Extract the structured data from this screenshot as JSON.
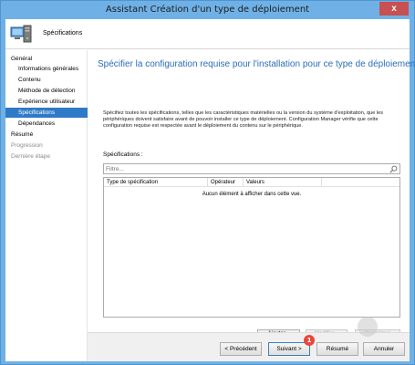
{
  "window": {
    "title": "Assistant Création d'un type de déploiement",
    "close_glyph": "x"
  },
  "header": {
    "title": "Spécifications",
    "icon": "computer-icon"
  },
  "sidebar": {
    "items": [
      {
        "label": "Général",
        "state": "normal"
      },
      {
        "label": "Informations générales",
        "state": "normal"
      },
      {
        "label": "Contenu",
        "state": "normal"
      },
      {
        "label": "Méthode de détection",
        "state": "normal"
      },
      {
        "label": "Expérience utilisateur",
        "state": "normal"
      },
      {
        "label": "Spécifications",
        "state": "active"
      },
      {
        "label": "Dépendances",
        "state": "normal"
      },
      {
        "label": "Résumé",
        "state": "normal"
      },
      {
        "label": "Progression",
        "state": "dim"
      },
      {
        "label": "Dernière étape",
        "state": "dim"
      }
    ]
  },
  "main": {
    "heading": "Spécifier la configuration requise pour l'installation pour ce type de déploiement",
    "description": "Spécifiez toutes les spécifications, telles que les caractéristiques matérielles ou la version du système d'exploitation, que les périphériques doivent satisfaire avant de pouvoir installer ce type de déploiement. Configuration Manager vérifie que cette configuration requise est respectée avant le déploiement du contenu sur le périphérique.",
    "list_label": "Spécifications :",
    "filter_placeholder": "Filtre...",
    "columns": [
      "Type de spécification",
      "Opérateur",
      "Valeurs"
    ],
    "empty_message": "Aucun élément à afficher dans cette vue.",
    "buttons": {
      "add": "Ajouter...",
      "edit": "Modifier...",
      "delete": "Supprimer"
    }
  },
  "footer": {
    "previous": "< Précédent",
    "next": "Suivant >",
    "summary": "Résumé",
    "cancel": "Annuler"
  },
  "annotation": {
    "badge": "1"
  },
  "colors": {
    "title_bar": "#6fb1e6",
    "heading": "#2a6eb8",
    "active_nav": "#2f7ac6",
    "badge": "#e8473a"
  }
}
